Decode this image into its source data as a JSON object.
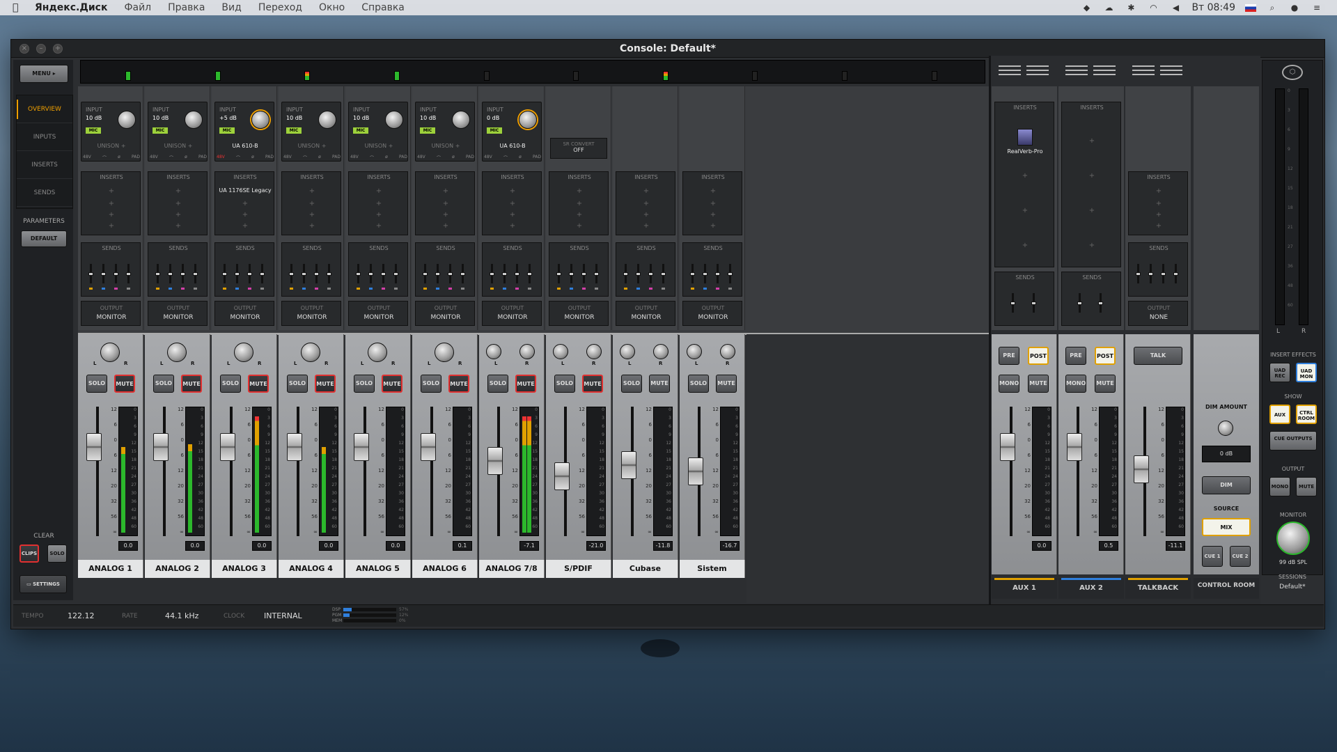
{
  "menubar": {
    "app": "Яндекс.Диск",
    "items": [
      "Файл",
      "Правка",
      "Вид",
      "Переход",
      "Окно",
      "Справка"
    ],
    "time": "Вт 08:49"
  },
  "window": {
    "title": "Console: Default*"
  },
  "left": {
    "menu": "MENU",
    "nav": [
      "OVERVIEW",
      "INPUTS",
      "INSERTS",
      "SENDS"
    ],
    "parameters": "PARAMETERS",
    "default": "DEFAULT",
    "clear": "CLEAR",
    "clips": "CLIPS",
    "solo": "SOLO",
    "settings": "SETTINGS"
  },
  "channels": [
    {
      "name": "ANALOG 1",
      "input": "INPUT",
      "gain": "10 dB",
      "type": "UNISON +",
      "inserts": "INSERTS",
      "plugin": "",
      "sends": "SENDS",
      "out_lbl": "OUTPUT",
      "out": "MONITOR",
      "solo": "SOLO",
      "mute": "MUTE",
      "val": "0.0",
      "level": 0.7,
      "fader": 0.74
    },
    {
      "name": "ANALOG 2",
      "input": "INPUT",
      "gain": "10 dB",
      "type": "UNISON +",
      "inserts": "INSERTS",
      "plugin": "",
      "sends": "SENDS",
      "out_lbl": "OUTPUT",
      "out": "MONITOR",
      "solo": "SOLO",
      "mute": "MUTE",
      "val": "0.0",
      "level": 0.72,
      "fader": 0.74
    },
    {
      "name": "ANALOG 3",
      "input": "INPUT",
      "gain": "+5 dB",
      "type": "UA 610-B",
      "inserts": "INSERTS",
      "plugin": "UA 1176SE Legacy",
      "sends": "SENDS",
      "out_lbl": "OUTPUT",
      "out": "MONITOR",
      "solo": "SOLO",
      "mute": "MUTE",
      "val": "0.0",
      "level": 0.95,
      "fader": 0.74
    },
    {
      "name": "ANALOG 4",
      "input": "INPUT",
      "gain": "10 dB",
      "type": "UNISON +",
      "inserts": "INSERTS",
      "plugin": "",
      "sends": "SENDS",
      "out_lbl": "OUTPUT",
      "out": "MONITOR",
      "solo": "SOLO",
      "mute": "MUTE",
      "val": "0.0",
      "level": 0.7,
      "fader": 0.74
    },
    {
      "name": "ANALOG 5",
      "input": "INPUT",
      "gain": "10 dB",
      "type": "UNISON +",
      "inserts": "INSERTS",
      "plugin": "",
      "sends": "SENDS",
      "out_lbl": "OUTPUT",
      "out": "MONITOR",
      "solo": "SOLO",
      "mute": "MUTE",
      "val": "0.0",
      "level": 0,
      "fader": 0.74
    },
    {
      "name": "ANALOG 6",
      "input": "INPUT",
      "gain": "10 dB",
      "type": "UNISON +",
      "inserts": "INSERTS",
      "plugin": "",
      "sends": "SENDS",
      "out_lbl": "OUTPUT",
      "out": "MONITOR",
      "solo": "SOLO",
      "mute": "MUTE",
      "val": "0.1",
      "level": 0,
      "fader": 0.74
    },
    {
      "name": "ANALOG 7/8",
      "input": "INPUT",
      "gain": "0 dB",
      "type": "UA 610-B",
      "inserts": "INSERTS",
      "plugin": "",
      "sends": "SENDS",
      "out_lbl": "OUTPUT",
      "out": "MONITOR",
      "solo": "SOLO",
      "mute": "MUTE",
      "val": "-7.1",
      "level": 0.95,
      "fader": 0.6
    },
    {
      "name": "S/PDIF",
      "input": "SR CONVERT",
      "gain": "OFF",
      "type": "",
      "inserts": "INSERTS",
      "plugin": "",
      "sends": "SENDS",
      "out_lbl": "OUTPUT",
      "out": "MONITOR",
      "solo": "SOLO",
      "mute": "MUTE",
      "val": "-21.0",
      "level": 0,
      "fader": 0.45
    },
    {
      "name": "Cubase",
      "input": "",
      "gain": "",
      "type": "",
      "inserts": "INSERTS",
      "plugin": "",
      "sends": "SENDS",
      "out_lbl": "OUTPUT",
      "out": "MONITOR",
      "solo": "SOLO",
      "mute": "MUTE",
      "val": "-11.8",
      "level": 0,
      "fader": 0.56
    },
    {
      "name": "Sistem",
      "input": "",
      "gain": "",
      "type": "",
      "inserts": "INSERTS",
      "plugin": "",
      "sends": "SENDS",
      "out_lbl": "OUTPUT",
      "out": "MONITOR",
      "solo": "SOLO",
      "mute": "MUTE",
      "val": "-16.7",
      "level": 0,
      "fader": 0.5
    }
  ],
  "fader_scale": [
    "12",
    "6",
    "0",
    "6",
    "12",
    "20",
    "32",
    "56",
    "∞"
  ],
  "meter_scale": [
    "0",
    "3",
    "6",
    "9",
    "12",
    "15",
    "18",
    "21",
    "24",
    "27",
    "30",
    "36",
    "42",
    "48",
    "60"
  ],
  "buses": [
    {
      "name": "AUX 1",
      "inserts": "INSERTS",
      "plugin": "RealVerb-Pro",
      "sends": "SENDS",
      "pre": "PRE",
      "post": "POST",
      "mono": "MONO",
      "mute": "MUTE",
      "val": "0.0",
      "color": "#e0a000"
    },
    {
      "name": "AUX 2",
      "inserts": "INSERTS",
      "plugin": "",
      "sends": "SENDS",
      "pre": "PRE",
      "post": "POST",
      "mono": "MONO",
      "mute": "MUTE",
      "val": "0.5",
      "color": "#2f7fdc"
    },
    {
      "name": "TALKBACK",
      "inserts": "INSERTS",
      "plugin": "",
      "sends": "SENDS",
      "out_lbl": "OUTPUT",
      "out": "NONE",
      "talk": "TALK",
      "val": "-11.1",
      "color": "#e0a000"
    }
  ],
  "control_room": {
    "name": "CONTROL ROOM",
    "dim_amount": "DIM AMOUNT",
    "dim_val": "0 dB",
    "dim": "DIM",
    "source": "SOURCE",
    "mix": "MIX",
    "cue1": "CUE 1",
    "cue2": "CUE 2"
  },
  "ua": {
    "l": "L",
    "r": "R",
    "insert_effects": "INSERT EFFECTS",
    "uad_rec": "UAD REC",
    "uad_mon": "UAD MON",
    "show": "SHOW",
    "aux": "AUX",
    "ctrl_room": "CTRL ROOM",
    "cue_outputs": "CUE OUTPUTS",
    "output": "OUTPUT",
    "mono": "MONO",
    "mute": "MUTE",
    "monitor": "MONITOR",
    "spl": "99 dB SPL",
    "sessions": "SESSIONS",
    "session": "Default*",
    "meter_scale": [
      "0",
      "3",
      "6",
      "9",
      "12",
      "15",
      "18",
      "21",
      "27",
      "36",
      "48",
      "60"
    ]
  },
  "bottom": {
    "tempo_lbl": "TEMPO",
    "tempo": "122.12",
    "rate_lbl": "RATE",
    "rate": "44.1 kHz",
    "clock_lbl": "CLOCK",
    "clock": "INTERNAL",
    "dsp": "DSP",
    "pgm": "PGM",
    "mem": "MEM",
    "dsp_v": "57%",
    "pgm_v": "12%",
    "mem_v": "0%"
  }
}
